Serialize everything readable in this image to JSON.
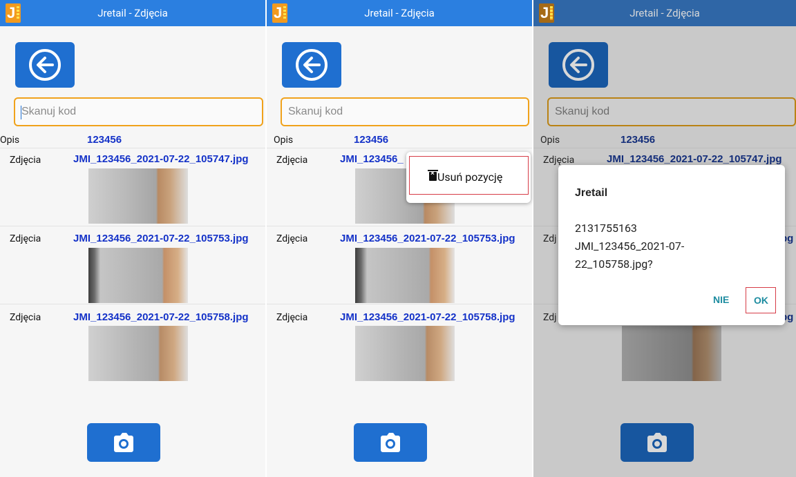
{
  "app": {
    "title": "Jretail - Zdjęcia",
    "logo_letter": "J"
  },
  "back_button": {
    "icon": "arrow-left-circle-icon"
  },
  "scan_input": {
    "placeholder": "Skanuj kod",
    "value": ""
  },
  "opis": {
    "label": "Opis",
    "value": "123456"
  },
  "photos": [
    {
      "label": "Zdjęcia",
      "file": "JMI_123456_2021-07-22_105747.jpg"
    },
    {
      "label": "Zdjęcia",
      "file": "JMI_123456_2021-07-22_105753.jpg"
    },
    {
      "label": "Zdjęcia",
      "file": "JMI_123456_2021-07-22_105758.jpg"
    }
  ],
  "camera_button": {
    "icon": "camera-icon"
  },
  "screens": {
    "second": {
      "truncated_file": "JMI_123456_"
    },
    "third": {
      "row2_label_clipped": "Zdj",
      "row3_label_clipped": "Zdj",
      "row2_file_tail": "pg",
      "row3_file_tail": "pg"
    }
  },
  "context_menu": {
    "item_label": "Usuń pozycję",
    "item_icon": "trash-icon"
  },
  "dialog": {
    "title": "Jretail",
    "message_lines": [
      "2131755163",
      "JMI_123456_2021-07-",
      "22_105758.jpg?"
    ],
    "no_label": "NIE",
    "ok_label": "OK"
  },
  "colors": {
    "title_bar": "#2b7fe0",
    "button": "#1f6fd0",
    "input_border": "#f0a21b",
    "filename": "#1432c8",
    "highlight_box": "#d63b46",
    "dialog_button": "#1d8ca0"
  }
}
